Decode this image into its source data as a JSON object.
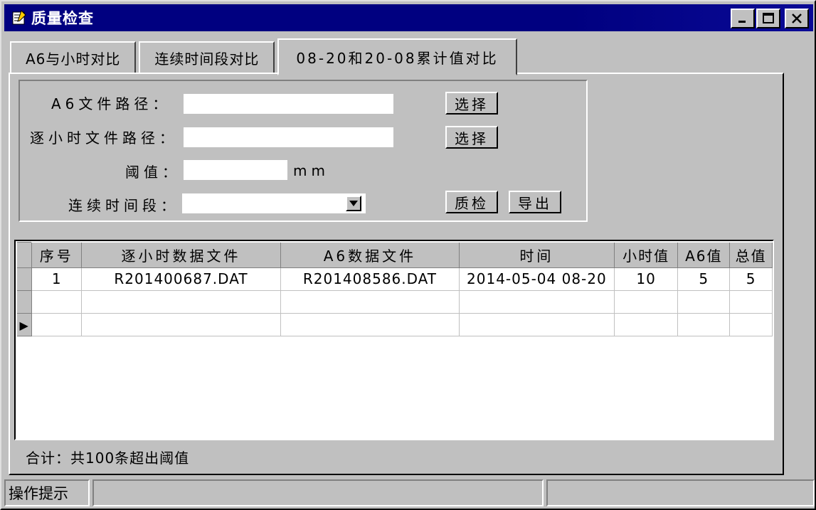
{
  "window": {
    "title": "质量检查",
    "icon": "app-icon",
    "minimize": "_",
    "maximize": "□",
    "close": "×"
  },
  "tabs": [
    {
      "label": "A6与小时对比",
      "active": false
    },
    {
      "label": "连续时间段对比",
      "active": false
    },
    {
      "label": "08-20和20-08累计值对比",
      "active": true
    }
  ],
  "form": {
    "a6_path_label": "A6文件路径：",
    "a6_path_value": "",
    "a6_select_button": "选择",
    "hourly_path_label": "逐小时文件路径：",
    "hourly_path_value": "",
    "hourly_select_button": "选择",
    "threshold_label": "阈值：",
    "threshold_value": "",
    "threshold_unit": "mm",
    "period_label": "连续时间段：",
    "period_value": "",
    "qc_button": "质检",
    "export_button": "导出"
  },
  "grid": {
    "columns": [
      "序号",
      "逐小时数据文件",
      "A6数据文件",
      "时间",
      "小时值",
      "A6值",
      "总值"
    ],
    "rows": [
      [
        "1",
        "R201400687.DAT",
        "R201408586.DAT",
        "2014-05-04 08-20",
        "10",
        "5",
        "5"
      ],
      [
        "",
        "",
        "",
        "",
        "",
        "",
        ""
      ],
      [
        "",
        "",
        "",
        "",
        "",
        "",
        ""
      ]
    ],
    "current_row_indicator": "▶"
  },
  "summary": "合计：共100条超出阈值",
  "statusbar": {
    "hint": "操作提示",
    "panel2": "",
    "panel3": ""
  },
  "colors": {
    "titlebar": "#000080",
    "face": "#c0c0c0"
  }
}
